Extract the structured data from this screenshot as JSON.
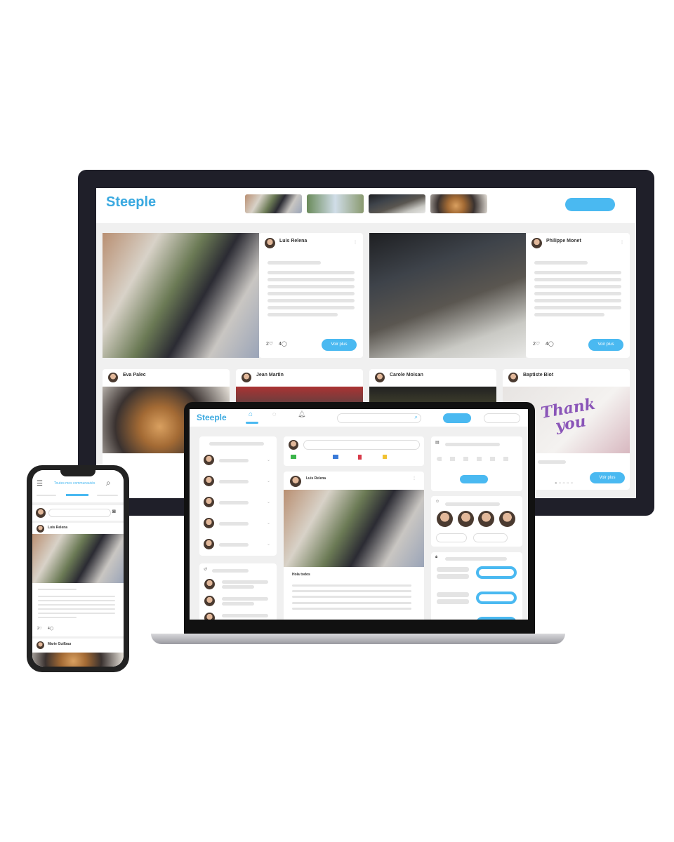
{
  "brand": {
    "logo": "Steeple",
    "accent": "#4ab9f1"
  },
  "desktop": {
    "featured_posts": [
      {
        "author": "Luis Relena",
        "likes": "2",
        "comments": "4",
        "button": "Voir plus"
      },
      {
        "author": "Philippe Monet",
        "likes": "2",
        "comments": "4",
        "button": "Voir plus"
      }
    ],
    "posts": [
      {
        "author": "Eva Palec"
      },
      {
        "author": "Jean Martin"
      },
      {
        "author": "Carole Moisan"
      },
      {
        "author": "Baptiste Biot",
        "image_text": "Thank you",
        "button": "Voir plus"
      }
    ]
  },
  "laptop": {
    "nav_icons": [
      "home-icon",
      "chat-icon",
      "bell-icon"
    ],
    "post": {
      "author": "Luis Relena",
      "body": "Hola todos"
    }
  },
  "phone": {
    "title": "Toutes mes communautés",
    "post": {
      "author": "Luis Relena",
      "likes": "2",
      "comments": "4"
    },
    "next_post": {
      "author": "Marie Guilbau"
    }
  }
}
